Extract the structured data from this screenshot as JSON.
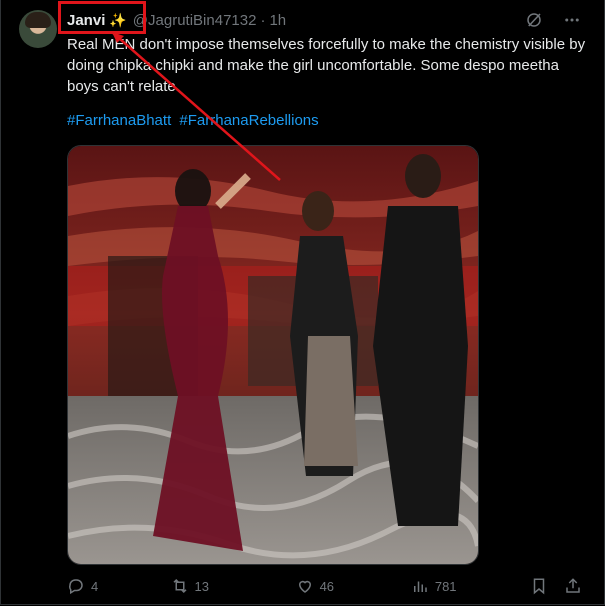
{
  "tweet": {
    "author_name": "Janvi",
    "author_emoji": "✨",
    "handle": "@JagrutiBin47132",
    "separator": "·",
    "time": "1h",
    "text": "Real MEN don't impose themselves forcefully to make the chemistry visible by doing chipka chipki and make the girl uncomfortable. Some despo meetha boys can't relate",
    "hashtags": [
      "#FarrhanaBhatt",
      "#FarrhanaRebellions"
    ]
  },
  "actions": {
    "replies": "4",
    "reposts": "13",
    "likes": "46",
    "views": "781"
  },
  "icons": {
    "grok": "grok-icon",
    "more": "more-icon",
    "reply": "reply-icon",
    "repost": "repost-icon",
    "like": "heart-icon",
    "views": "views-icon",
    "bookmark": "bookmark-icon",
    "share": "share-icon"
  },
  "colors": {
    "background": "#000000",
    "text": "#e7e9ea",
    "muted": "#71767b",
    "link": "#1d9bf0",
    "annotation": "#e0151b"
  }
}
